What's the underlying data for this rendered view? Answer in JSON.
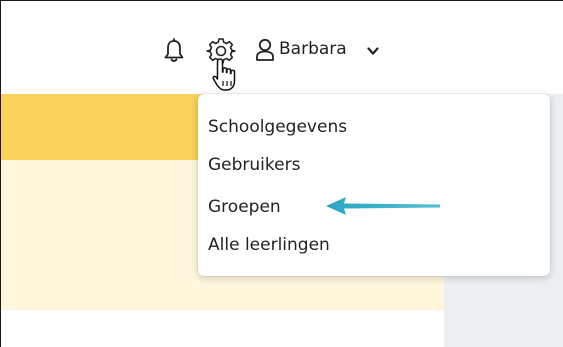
{
  "header": {
    "user_name": "Barbara",
    "icons": {
      "notifications": "bell-icon",
      "settings": "gear-icon",
      "cursor": "hand-pointer-icon",
      "user": "user-icon",
      "dropdown": "chevron-down-icon"
    }
  },
  "dropdown": {
    "items": [
      {
        "label": "Schoolgegevens"
      },
      {
        "label": "Gebruikers"
      },
      {
        "label": "Groepen"
      },
      {
        "label": "Alle leerlingen"
      }
    ]
  },
  "colors": {
    "banner": "#f8d25c",
    "panel": "#fff6dc",
    "side": "#eceff1",
    "arrow": "#3aaec8"
  }
}
